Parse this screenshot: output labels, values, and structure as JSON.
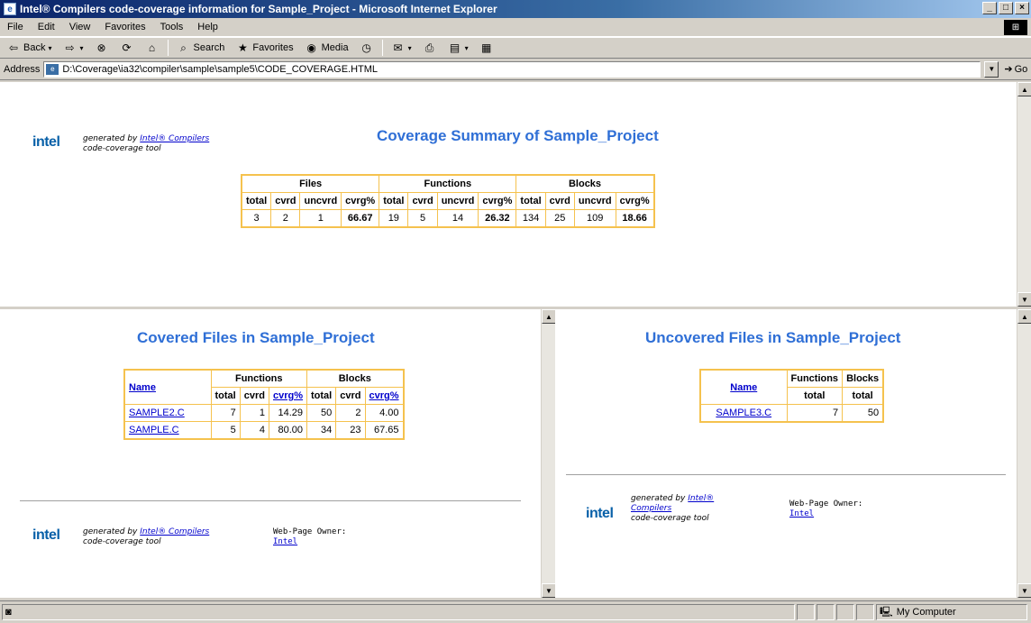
{
  "window": {
    "title": "Intel® Compilers code-coverage information for Sample_Project - Microsoft Internet Explorer"
  },
  "menu": [
    "File",
    "Edit",
    "View",
    "Favorites",
    "Tools",
    "Help"
  ],
  "toolbar": {
    "back": "Back",
    "search": "Search",
    "favorites": "Favorites",
    "media": "Media"
  },
  "address": {
    "label": "Address",
    "url": "D:\\Coverage\\ia32\\compiler\\sample\\sample5\\CODE_COVERAGE.HTML",
    "go": "Go"
  },
  "logo": "intel",
  "generated": {
    "prefix": "generated by",
    "link": "Intel® Compilers",
    "suffix": "code-coverage tool",
    "link_part1": "Intel®",
    "link_part2": "Compilers"
  },
  "owner": {
    "label": "Web-Page Owner:",
    "link": "Intel"
  },
  "summary": {
    "title": "Coverage Summary of Sample_Project",
    "groups": [
      "Files",
      "Functions",
      "Blocks"
    ],
    "cols": [
      "total",
      "cvrd",
      "uncvrd",
      "cvrg%"
    ],
    "files": [
      "3",
      "2",
      "1",
      "66.67"
    ],
    "functions": [
      "19",
      "5",
      "14",
      "26.32"
    ],
    "blocks": [
      "134",
      "25",
      "109",
      "18.66"
    ]
  },
  "covered": {
    "title": "Covered Files in Sample_Project",
    "name_header": "Name",
    "groups": [
      "Functions",
      "Blocks"
    ],
    "cols": [
      "total",
      "cvrd",
      "cvrg%"
    ],
    "rows": [
      {
        "name": "SAMPLE2.C",
        "f_total": "7",
        "f_cvrd": "1",
        "f_pct": "14.29",
        "b_total": "50",
        "b_cvrd": "2",
        "b_pct": "4.00"
      },
      {
        "name": "SAMPLE.C",
        "f_total": "5",
        "f_cvrd": "4",
        "f_pct": "80.00",
        "b_total": "34",
        "b_cvrd": "23",
        "b_pct": "67.65"
      }
    ]
  },
  "uncovered": {
    "title": "Uncovered Files in Sample_Project",
    "name_header": "Name",
    "groups": [
      "Functions",
      "Blocks"
    ],
    "col": "total",
    "rows": [
      {
        "name": "SAMPLE3.C",
        "f_total": "7",
        "b_total": "50"
      }
    ]
  },
  "status": {
    "zone": "My Computer"
  }
}
